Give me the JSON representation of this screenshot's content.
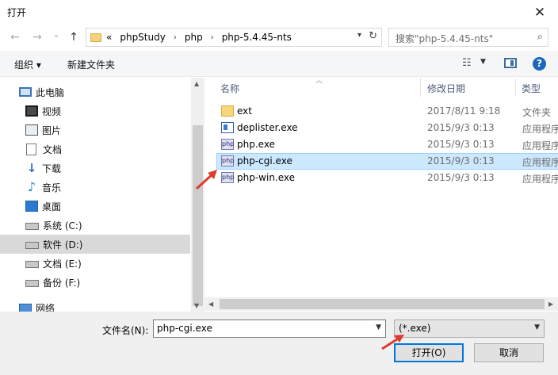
{
  "window": {
    "title": "打开",
    "close_glyph": "✕"
  },
  "nav": {
    "back_glyph": "←",
    "forward_glyph": "→",
    "recent_glyph": "⌄",
    "up_glyph": "↑",
    "breadcrumbs": [
      "«",
      "phpStudy",
      "php",
      "php-5.4.45-nts"
    ],
    "refresh_glyph": "↻",
    "search_placeholder": "搜索\"php-5.4.45-nts\""
  },
  "toolbar": {
    "organize_label": "组织 ▾",
    "new_folder_label": "新建文件夹",
    "help_label": "?"
  },
  "sidebar": {
    "items": [
      {
        "label": "此电脑",
        "icon": "computer-icon",
        "selected": false
      },
      {
        "label": "视频",
        "icon": "video-icon",
        "selected": false
      },
      {
        "label": "图片",
        "icon": "picture-icon",
        "selected": false
      },
      {
        "label": "文档",
        "icon": "document-icon",
        "selected": false
      },
      {
        "label": "下载",
        "icon": "download-icon",
        "selected": false
      },
      {
        "label": "音乐",
        "icon": "music-icon",
        "selected": false
      },
      {
        "label": "桌面",
        "icon": "desktop-icon",
        "selected": false
      },
      {
        "label": "系统 (C:)",
        "icon": "drive-icon",
        "selected": false
      },
      {
        "label": "软件 (D:)",
        "icon": "drive-icon",
        "selected": true
      },
      {
        "label": "文档 (E:)",
        "icon": "drive-icon",
        "selected": false
      },
      {
        "label": "备份 (F:)",
        "icon": "drive-icon",
        "selected": false
      },
      {
        "label": "网络",
        "icon": "network-icon",
        "selected": false
      }
    ]
  },
  "file_list": {
    "columns": [
      "名称",
      "修改日期",
      "类型"
    ],
    "rows": [
      {
        "name": "ext",
        "date": "2017/8/11 9:18",
        "type": "文件夹",
        "icon": "folder-icon",
        "selected": false
      },
      {
        "name": "deplister.exe",
        "date": "2015/9/3 0:13",
        "type": "应用程序",
        "icon": "exe-icon",
        "selected": false
      },
      {
        "name": "php.exe",
        "date": "2015/9/3 0:13",
        "type": "应用程序",
        "icon": "php-icon",
        "selected": false
      },
      {
        "name": "php-cgi.exe",
        "date": "2015/9/3 0:13",
        "type": "应用程序",
        "icon": "php-icon",
        "selected": true
      },
      {
        "name": "php-win.exe",
        "date": "2015/9/3 0:13",
        "type": "应用程序",
        "icon": "php-icon",
        "selected": false
      }
    ],
    "php_icon_text": "php"
  },
  "footer": {
    "filename_label": "文件名(N):",
    "filename_value": "php-cgi.exe",
    "filter_value": "(*.exe)",
    "open_label": "打开(O)",
    "cancel_label": "取消"
  },
  "colors": {
    "accent": "#0078d7",
    "selection": "#cce8ff",
    "annotation_arrow": "#e03a2e"
  }
}
